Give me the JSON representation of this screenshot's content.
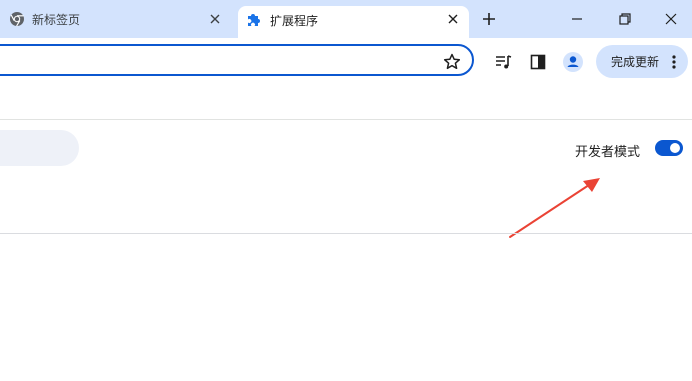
{
  "tabs": [
    {
      "title": "新标签页",
      "icon": "chrome-icon",
      "active": false
    },
    {
      "title": "扩展程序",
      "icon": "puzzle-icon",
      "active": true
    }
  ],
  "toolbar": {
    "update_label": "完成更新"
  },
  "page": {
    "developer_mode_label": "开发者模式",
    "developer_mode_on": true
  },
  "colors": {
    "titlebar": "#d3e3fd",
    "accent": "#0b57d0",
    "annotation_arrow": "#ea4335"
  }
}
